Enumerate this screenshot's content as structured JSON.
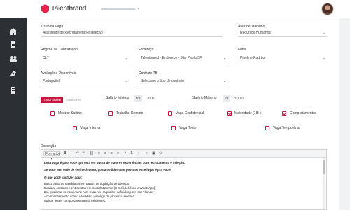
{
  "app": {
    "brand_name": "Talentbrand",
    "brand_color": "#e8204a",
    "accent_color": "#c8143f",
    "sidebar_color": "#2c2f34"
  },
  "sidebar": {
    "items": [
      {
        "icon": "home-icon"
      },
      {
        "icon": "document-icon"
      },
      {
        "icon": "people-icon"
      },
      {
        "icon": "settings-icon"
      },
      {
        "icon": "list-icon"
      }
    ]
  },
  "form": {
    "titulo_label": "Título da Vaga",
    "titulo_value": "Assistente de Recrutamento e seleção",
    "area_label": "Área de Trabalho",
    "area_value": "Recursos Humanos",
    "regime_label": "Regime de Contratação",
    "regime_value": "CLT",
    "endereco_label": "Endereço",
    "endereco_value": "Talentbrand - Endereço - São Paulo/SP",
    "funil_label": "Funil",
    "funil_value": "Pipeline Padrão",
    "avaliacoes_label": "Avaliações Disponíveis",
    "avaliacoes_value": "Português I",
    "contrato_label": "Contrato TB",
    "contrato_value": "Selecione o tipo de contrato",
    "salary_toggle": {
      "active": "Faixa Salarial",
      "inactive": "Salário Fixo"
    },
    "salario_min_label": "Salário Mínimo",
    "salario_min_prefix": "R$",
    "salario_min_value": "1200.0",
    "salario_max_label": "Salário Máximo",
    "salario_max_prefix": "R$",
    "salario_max_value": "2000.0",
    "checkboxes": [
      {
        "label": "Mostrar Salário",
        "checked": false
      },
      {
        "label": "Trabalho Remoto",
        "checked": false
      },
      {
        "label": "Vaga Confidencial",
        "checked": false
      },
      {
        "label": "Maioridade (18+)",
        "checked": true
      },
      {
        "label": "Comportamentos",
        "checked": true
      },
      {
        "label": "Vaga Interna",
        "checked": false
      },
      {
        "label": "Vaga Teste",
        "checked": false
      },
      {
        "label": "Vaga Temporária",
        "checked": false
      }
    ],
    "descricao_label": "Descrição"
  },
  "editor": {
    "format_label": "Formatos",
    "buttons": [
      "bold-icon",
      "italic-icon",
      "undo-icon",
      "redo-icon",
      "link-icon",
      "align-left-icon",
      "align-center-icon",
      "align-right-icon",
      "align-justify-icon",
      "bullet-list-icon",
      "numbered-list-icon",
      "outdent-icon",
      "indent-icon",
      "image-icon",
      "code-icon"
    ],
    "lines": [
      "Essa vaga é para você que está em busca de maiores experiências com recrutamento e seleção.",
      "Se você tem sede de conhecimento, gosta de lidar com pessoas esse lugar é pra você!",
      "O que você vai fazer aqui:",
      "Busca ativa de candidatos em canais de aquisição de talentos;",
      "Realizar contatos e entrevistas em multiplataforma (E-mail, telefone e WhatsApp);",
      "Pré qualificar os candidatos com base nos requisitos definidos junto aos clientes;",
      "Acompanhamento com o candidato ao longo do processo seletivo;",
      "Aplicar testes comportamentais já existentes;"
    ]
  }
}
